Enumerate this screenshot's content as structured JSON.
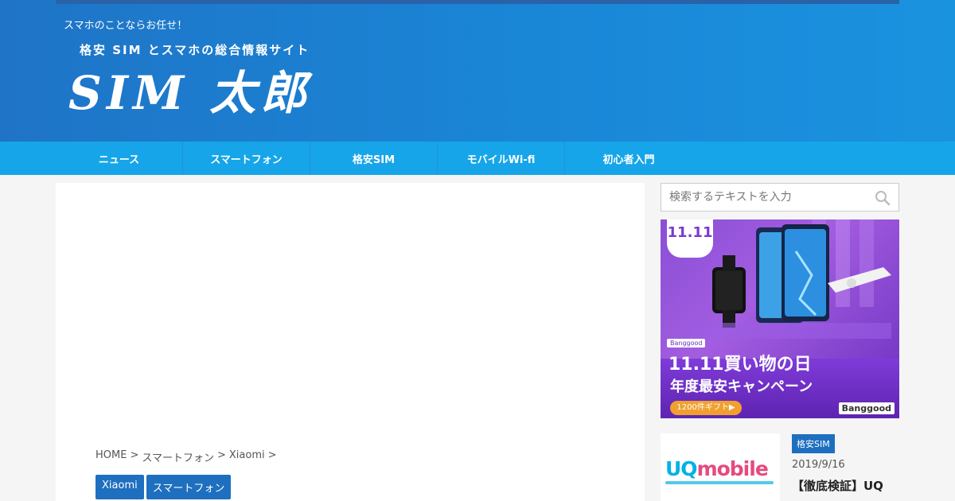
{
  "header": {
    "tagline": "スマホのことならお任せ！",
    "logo_sub": "格安 SIM とスマホの総合情報サイト",
    "logo_main": "SIM 太郎"
  },
  "nav": {
    "items": [
      "ニュース",
      "スマートフォン",
      "格安SIM",
      "モバイルWi-fi",
      "初心者入門"
    ]
  },
  "breadcrumb": {
    "items": [
      "HOME",
      ">",
      "スマートフォン",
      ">",
      "Xiaomi",
      ">"
    ]
  },
  "tags": [
    "Xiaomi",
    "スマートフォン"
  ],
  "search": {
    "placeholder": "検索するテキストを入力",
    "icon": "search-icon"
  },
  "ad": {
    "tab_text": "11.11",
    "line1": "11.11買い物の日",
    "line2": "年度最安キャンペーン",
    "button": "1200件ギフト▶",
    "brand": "Banggood",
    "badge": "Banggood",
    "colors": {
      "bg": "#8a4fd6",
      "button": "#f1a02e"
    }
  },
  "post": {
    "thumb_logo_a": "UQ",
    "thumb_logo_b": "mobile",
    "category": "格安SIM",
    "date": "2019/9/16",
    "title": "【徹底検証】UQ"
  },
  "colors": {
    "header": "#1a86d6",
    "nav": "#16a5e9",
    "tag": "#1e6fbf"
  }
}
